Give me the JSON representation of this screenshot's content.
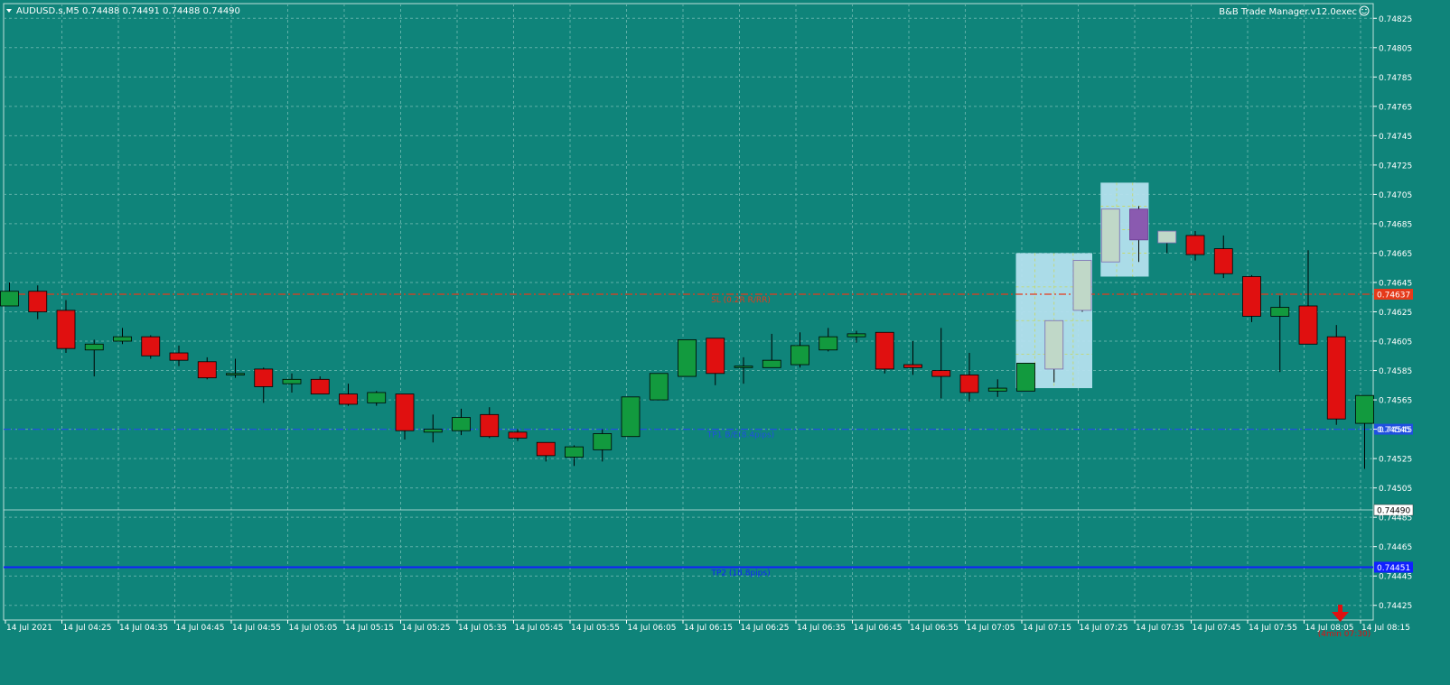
{
  "header": {
    "symbol_line": "AUDUSD.s,M5  0.74488 0.74491 0.74488 0.74490",
    "indicator_name": "B&B Trade Manager.v12.0exec"
  },
  "colors": {
    "background": "#0f847a",
    "grid": "#5fb0a8",
    "bull": "#129a3e",
    "bear": "#e01010",
    "zone_fill": "#b4e0ee",
    "purple_candle": "#8a5ab0",
    "pale_candle": "#c0d8c8",
    "sl_line": "#e53a1a",
    "tp_dash_line": "#2050e0",
    "tp2_line": "#1020ff",
    "axis_bg": "#ffffff"
  },
  "chart_data": {
    "type": "candlestick",
    "symbol": "AUDUSD.s",
    "timeframe": "M5",
    "ylim": [
      0.74415,
      0.74835
    ],
    "y_ticks": [
      "0.74825",
      "0.74805",
      "0.74785",
      "0.74765",
      "0.74745",
      "0.74725",
      "0.74705",
      "0.74685",
      "0.74665",
      "0.74645",
      "0.74625",
      "0.74605",
      "0.74585",
      "0.74565",
      "0.74545",
      "0.74525",
      "0.74505",
      "0.74485",
      "0.74465",
      "0.74445",
      "0.74425"
    ],
    "x_labels": [
      "14 Jul 2021",
      "14 Jul 04:25",
      "14 Jul 04:35",
      "14 Jul 04:45",
      "14 Jul 04:55",
      "14 Jul 05:05",
      "14 Jul 05:15",
      "14 Jul 05:25",
      "14 Jul 05:35",
      "14 Jul 05:45",
      "14 Jul 05:55",
      "14 Jul 06:05",
      "14 Jul 06:15",
      "14 Jul 06:25",
      "14 Jul 06:35",
      "14 Jul 06:45",
      "14 Jul 06:55",
      "14 Jul 07:05",
      "14 Jul 07:15",
      "14 Jul 07:25",
      "14 Jul 07:35",
      "14 Jul 07:45",
      "14 Jul 07:55",
      "14 Jul 08:05",
      "14 Jul 08:15"
    ],
    "candles": [
      {
        "o": 0.74629,
        "h": 0.74645,
        "l": 0.74629,
        "c": 0.74639
      },
      {
        "o": 0.74639,
        "h": 0.74643,
        "l": 0.7462,
        "c": 0.74625
      },
      {
        "o": 0.74626,
        "h": 0.74633,
        "l": 0.74597,
        "c": 0.746
      },
      {
        "o": 0.74599,
        "h": 0.74606,
        "l": 0.74581,
        "c": 0.74603
      },
      {
        "o": 0.74605,
        "h": 0.74614,
        "l": 0.74603,
        "c": 0.74608
      },
      {
        "o": 0.74608,
        "h": 0.74609,
        "l": 0.74593,
        "c": 0.74595
      },
      {
        "o": 0.74597,
        "h": 0.74602,
        "l": 0.74588,
        "c": 0.74592
      },
      {
        "o": 0.74591,
        "h": 0.74594,
        "l": 0.74579,
        "c": 0.7458
      },
      {
        "o": 0.74582,
        "h": 0.74593,
        "l": 0.7458,
        "c": 0.74583
      },
      {
        "o": 0.74586,
        "h": 0.74587,
        "l": 0.74563,
        "c": 0.74574
      },
      {
        "o": 0.74576,
        "h": 0.74583,
        "l": 0.7457,
        "c": 0.74579
      },
      {
        "o": 0.74579,
        "h": 0.74581,
        "l": 0.74569,
        "c": 0.74569
      },
      {
        "o": 0.74569,
        "h": 0.74576,
        "l": 0.74561,
        "c": 0.74562
      },
      {
        "o": 0.74563,
        "h": 0.74571,
        "l": 0.74561,
        "c": 0.7457
      },
      {
        "o": 0.74569,
        "h": 0.74569,
        "l": 0.74538,
        "c": 0.74544
      },
      {
        "o": 0.74543,
        "h": 0.74555,
        "l": 0.74536,
        "c": 0.74545
      },
      {
        "o": 0.74544,
        "h": 0.74559,
        "l": 0.74541,
        "c": 0.74553
      },
      {
        "o": 0.74555,
        "h": 0.7456,
        "l": 0.74539,
        "c": 0.7454
      },
      {
        "o": 0.74543,
        "h": 0.74545,
        "l": 0.74537,
        "c": 0.74539
      },
      {
        "o": 0.74536,
        "h": 0.74535,
        "l": 0.74523,
        "c": 0.74527
      },
      {
        "o": 0.74526,
        "h": 0.74534,
        "l": 0.7452,
        "c": 0.74533
      },
      {
        "o": 0.74531,
        "h": 0.74545,
        "l": 0.74523,
        "c": 0.74542
      },
      {
        "o": 0.7454,
        "h": 0.74567,
        "l": 0.7454,
        "c": 0.74567
      },
      {
        "o": 0.74565,
        "h": 0.74583,
        "l": 0.74565,
        "c": 0.74583
      },
      {
        "o": 0.74581,
        "h": 0.74606,
        "l": 0.74581,
        "c": 0.74606
      },
      {
        "o": 0.74607,
        "h": 0.74607,
        "l": 0.74575,
        "c": 0.74583
      },
      {
        "o": 0.74587,
        "h": 0.74594,
        "l": 0.74576,
        "c": 0.74588
      },
      {
        "o": 0.74587,
        "h": 0.7461,
        "l": 0.74587,
        "c": 0.74592
      },
      {
        "o": 0.74589,
        "h": 0.74611,
        "l": 0.74587,
        "c": 0.74602
      },
      {
        "o": 0.74599,
        "h": 0.74614,
        "l": 0.74598,
        "c": 0.74608
      },
      {
        "o": 0.74608,
        "h": 0.74612,
        "l": 0.74604,
        "c": 0.7461
      },
      {
        "o": 0.74611,
        "h": 0.74611,
        "l": 0.74583,
        "c": 0.74586
      },
      {
        "o": 0.74589,
        "h": 0.74605,
        "l": 0.74582,
        "c": 0.74587
      },
      {
        "o": 0.74585,
        "h": 0.74614,
        "l": 0.74566,
        "c": 0.74581
      },
      {
        "o": 0.74582,
        "h": 0.74597,
        "l": 0.74564,
        "c": 0.7457
      },
      {
        "o": 0.74571,
        "h": 0.74579,
        "l": 0.74567,
        "c": 0.74573
      },
      {
        "o": 0.74571,
        "h": 0.7459,
        "l": 0.74571,
        "c": 0.7459
      },
      {
        "o": 0.74586,
        "h": 0.74618,
        "l": 0.74577,
        "c": 0.74619,
        "style": "pale"
      },
      {
        "o": 0.74626,
        "h": 0.7466,
        "l": 0.74625,
        "c": 0.7466,
        "style": "pale"
      },
      {
        "o": 0.74659,
        "h": 0.74695,
        "l": 0.74659,
        "c": 0.74695,
        "style": "pale"
      },
      {
        "o": 0.74695,
        "h": 0.74697,
        "l": 0.74659,
        "c": 0.74674,
        "style": "purple"
      },
      {
        "o": 0.74672,
        "h": 0.7468,
        "l": 0.74665,
        "c": 0.7468,
        "style": "pale"
      },
      {
        "o": 0.74677,
        "h": 0.7468,
        "l": 0.7466,
        "c": 0.74664
      },
      {
        "o": 0.74668,
        "h": 0.74677,
        "l": 0.74648,
        "c": 0.74651
      },
      {
        "o": 0.74649,
        "h": 0.7465,
        "l": 0.74618,
        "c": 0.74622
      },
      {
        "o": 0.74622,
        "h": 0.74636,
        "l": 0.74584,
        "c": 0.74628
      },
      {
        "o": 0.74629,
        "h": 0.74667,
        "l": 0.74603,
        "c": 0.74603
      },
      {
        "o": 0.74608,
        "h": 0.74616,
        "l": 0.74548,
        "c": 0.74552
      },
      {
        "o": 0.74549,
        "h": 0.74568,
        "l": 0.74518,
        "c": 0.74568
      }
    ],
    "zones": [
      {
        "start": 36,
        "end": 38,
        "top": 0.74665,
        "bottom": 0.74573
      },
      {
        "start": 39,
        "end": 40,
        "top": 0.74713,
        "bottom": 0.74649
      }
    ],
    "lines": [
      {
        "price": 0.74637,
        "style": "dashdot",
        "color": "#e53a1a",
        "label": "SL (0.2R R/RR)",
        "tag": "0.74637"
      },
      {
        "price": 0.74545,
        "style": "dashdot",
        "color": "#2050e0",
        "label": "TP1 B/E(8.4pips)",
        "tag": "0.74545"
      },
      {
        "price": 0.74451,
        "style": "solid",
        "color": "#1020ff",
        "label": "TP2 (18.8pips)",
        "tag": "0.74451"
      },
      {
        "price": 0.7449,
        "style": "bid",
        "color": "#cfe8e4",
        "label": "",
        "tag": "0.74490"
      }
    ],
    "countdown": "(4min 07:30)"
  }
}
